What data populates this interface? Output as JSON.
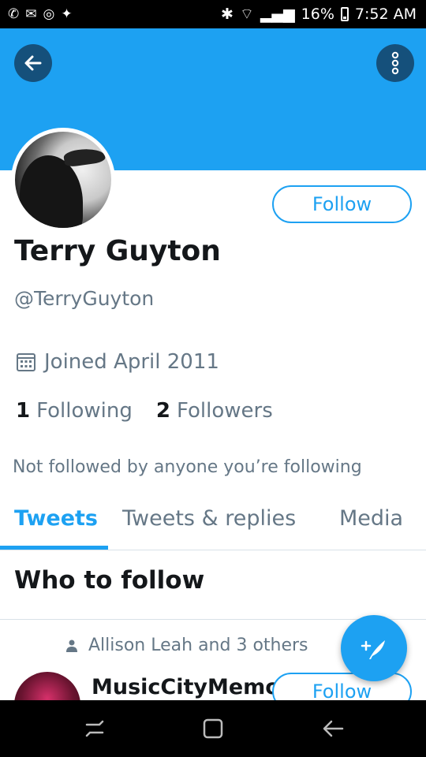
{
  "status_bar": {
    "battery": "16%",
    "time": "7:52 AM"
  },
  "profile": {
    "name": "Terry Guyton",
    "handle": "@TerryGuyton",
    "joined": "Joined April 2011",
    "following_count": "1",
    "following_label": "Following",
    "followers_count": "2",
    "followers_label": "Followers",
    "not_followed_text": "Not followed by anyone you’re following",
    "follow_label": "Follow"
  },
  "tabs": [
    {
      "label": "Tweets",
      "active": true
    },
    {
      "label": "Tweets & replies",
      "active": false
    },
    {
      "label": "Media",
      "active": false
    }
  ],
  "who_to_follow": {
    "title": "Who to follow",
    "suggestion": {
      "context": "Allison Leah and 3 others",
      "name": "MusicCityMemo",
      "follow_label": "Follow"
    }
  },
  "colors": {
    "accent": "#1da1f2",
    "header_button": "#15507b",
    "muted_text": "#657786"
  }
}
